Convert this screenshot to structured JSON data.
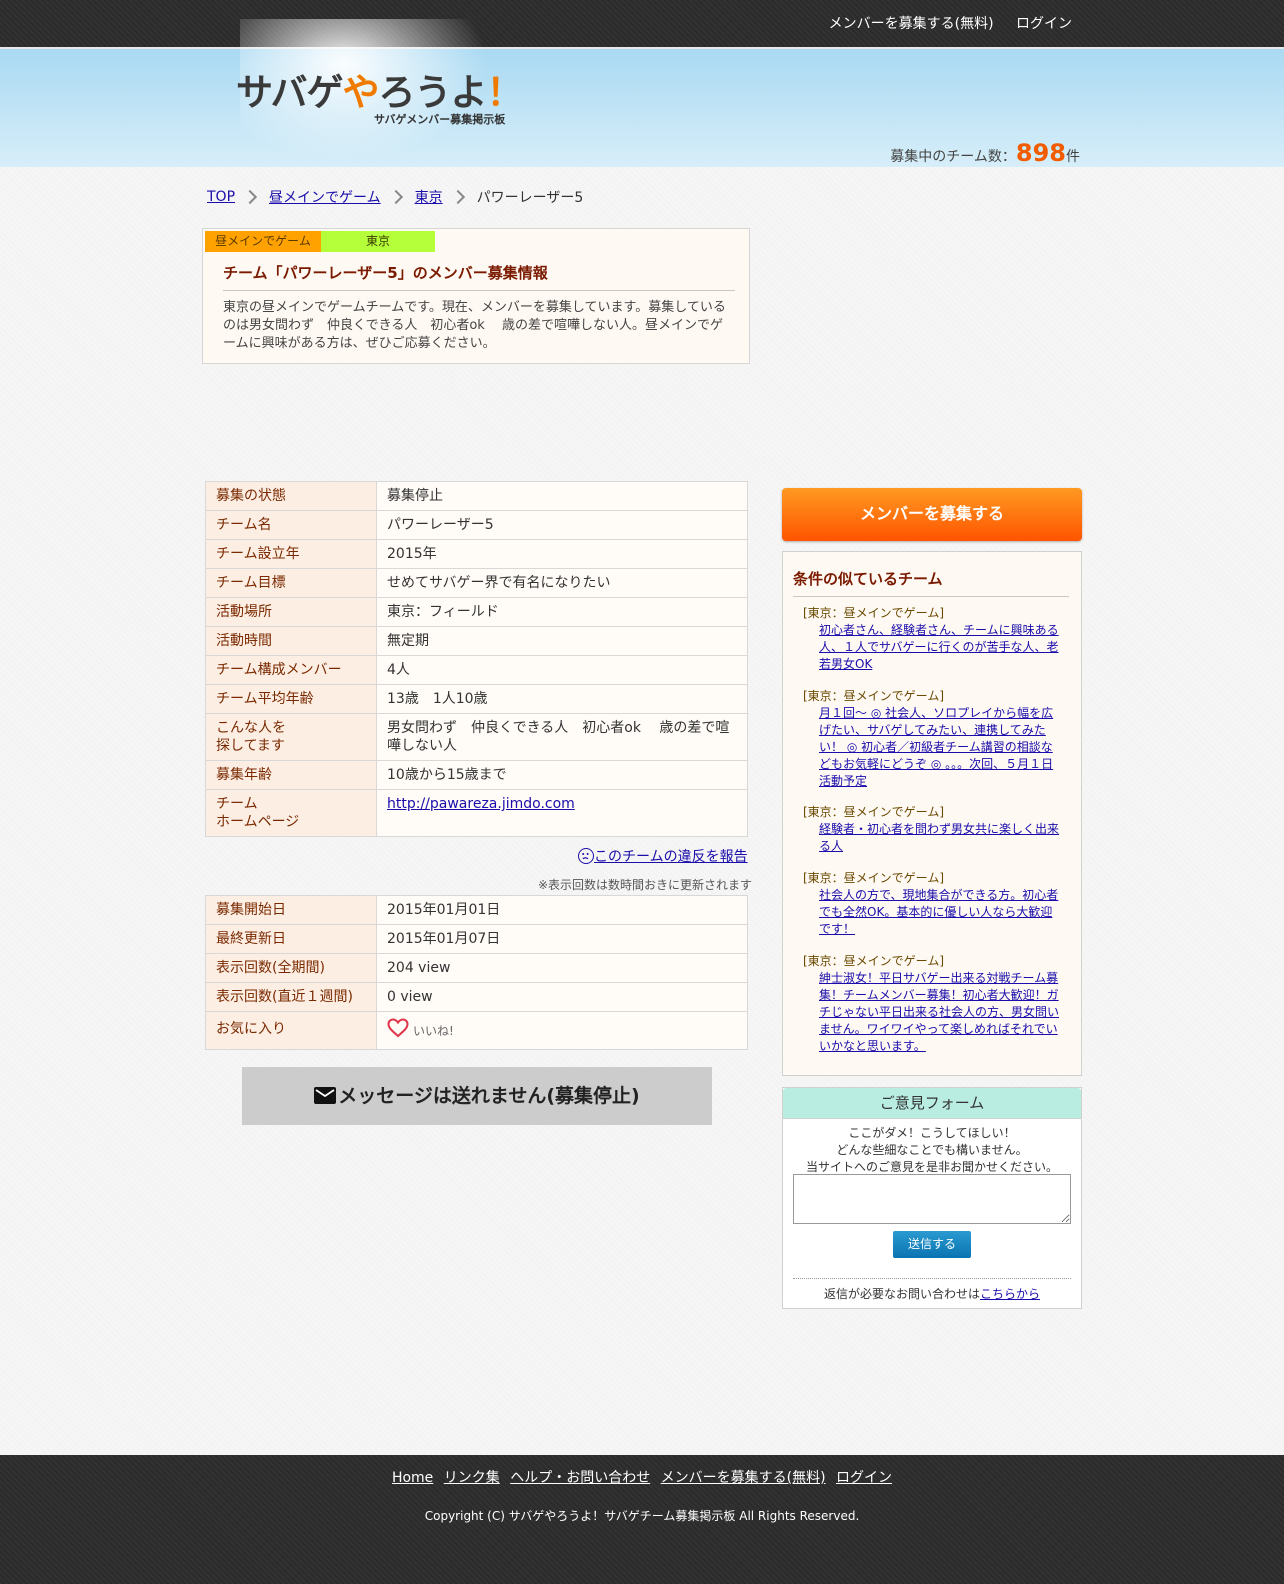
{
  "topnav": {
    "recruit": "メンバーを募集する(無料)",
    "login": "ログイン"
  },
  "header": {
    "logo_part1": "サバゲ",
    "logo_part2": "や",
    "logo_part3": "ろうよ",
    "logo_part4": "！",
    "logo_sub": "サバゲメンバー募集掲示板",
    "count_label": "募集中のチーム数：",
    "count_value": "898",
    "count_unit": "件"
  },
  "breadcrumb": {
    "top": "TOP",
    "category": "昼メインでゲーム",
    "area": "東京",
    "current": "パワーレーザー5"
  },
  "info": {
    "tag_category": "昼メインでゲーム",
    "tag_area": "東京",
    "title": "チーム「パワーレーザー5」のメンバー募集情報",
    "description": "東京の昼メインでゲームチームです。現在、メンバーを募集しています。募集しているのは男女問わず　仲良くできる人　初心者ok　 歳の差で喧嘩しない人。昼メインでゲームに興味がある方は、ぜひご応募ください。"
  },
  "details": [
    {
      "label": "募集の状態",
      "value": "募集停止"
    },
    {
      "label": "チーム名",
      "value": "パワーレーザー5"
    },
    {
      "label": "チーム設立年",
      "value": "2015年"
    },
    {
      "label": "チーム目標",
      "value": "せめてサバゲー界で有名になりたい"
    },
    {
      "label": "活動場所",
      "value": "東京：フィールド"
    },
    {
      "label": "活動時間",
      "value": "無定期"
    },
    {
      "label": "チーム構成メンバー",
      "value": "4人"
    },
    {
      "label": "チーム平均年齢",
      "value": "13歳　1人10歳"
    },
    {
      "label1": "こんな人を",
      "label2": "探してます",
      "value": "男女問わず　仲良くできる人　初心者ok　 歳の差で喧嘩しない人"
    },
    {
      "label": "募集年齢",
      "value": "10歳から15歳まで"
    },
    {
      "label1": "チーム",
      "label2": "ホームページ",
      "value": "http://pawareza.jimdo.com"
    }
  ],
  "report_link": "このチームの違反を報告",
  "stats_note": "※表示回数は数時間おきに更新されます",
  "stats": [
    {
      "label": "募集開始日",
      "value": "2015年01月01日"
    },
    {
      "label": "最終更新日",
      "value": "2015年01月07日"
    },
    {
      "label": "表示回数(全期間)",
      "value": "204 view"
    },
    {
      "label": "表示回数(直近１週間)",
      "value": "0 view"
    },
    {
      "label": "お気に入り",
      "value": "いいね!"
    }
  ],
  "message_button": "メッセージは送れません(募集停止)",
  "sidebar": {
    "recruit_button": "メンバーを募集する",
    "similar_title": "条件の似ているチーム",
    "similar": [
      {
        "cat": "[東京：昼メインでゲーム]",
        "text": "初心者さん、経験者さん、チームに興味ある人、１人でサバゲーに行くのが苦手な人、老若男女OK"
      },
      {
        "cat": "[東京：昼メインでゲーム]",
        "text": "月１回～ ◎ 社会人、ソロプレイから幅を広げたい、サバゲしてみたい、連携してみたい！ ◎ 初心者／初級者チーム講習の相談などもお気軽にどうぞ ◎ 。。。次回、５月１日活動予定"
      },
      {
        "cat": "[東京：昼メインでゲーム]",
        "text": "経験者・初心者を問わず男女共に楽しく出来る人"
      },
      {
        "cat": "[東京：昼メインでゲーム]",
        "text": "社会人の方で、現地集合ができる方。初心者でも全然OK。基本的に優しい人なら大歓迎です！"
      },
      {
        "cat": "[東京：昼メインでゲーム]",
        "text": "紳士淑女！平日サバゲー出来る対戦チーム募集！チームメンバー募集！初心者大歓迎！ガチじゃない平日出来る社会人の方、男女問いません。ワイワイやって楽しめればそれでいいかなと思います。"
      }
    ],
    "feedback_title": "ご意見フォーム",
    "feedback_line1": "ここがダメ！こうしてほしい！",
    "feedback_line2": "どんな些細なことでも構いません。",
    "feedback_line3": "当サイトへのご意見を是非お聞かせください。",
    "feedback_send": "送信する",
    "feedback_contact": "返信が必要なお問い合わせは",
    "feedback_contact_link": "こちらから"
  },
  "footer": {
    "links": [
      "Home",
      "リンク集",
      "ヘルプ・お問い合わせ",
      "メンバーを募集する(無料)",
      "ログイン"
    ],
    "copyright": "Copyright (C) サバゲやろうよ！サバゲチーム募集掲示板 All Rights Reserved."
  },
  "colors": {
    "accent": "#ff6a00",
    "header_sky": "#a9d9f2",
    "dark_bar": "#2b2b2b"
  }
}
